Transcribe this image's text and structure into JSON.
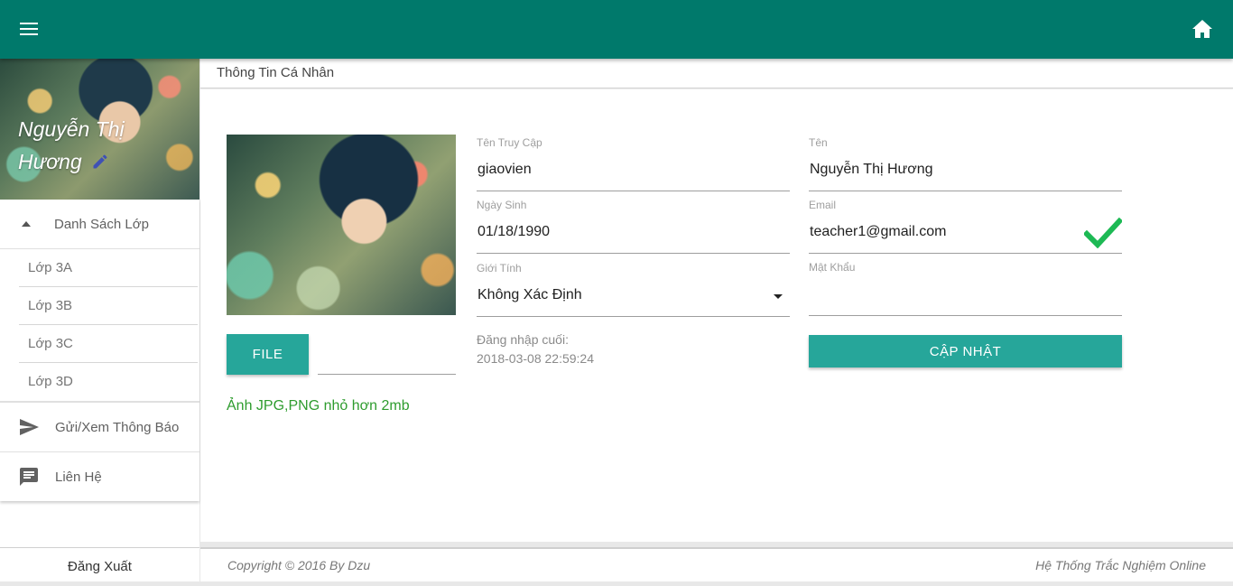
{
  "colors": {
    "primary": "#00796b",
    "button": "#26a69a",
    "success": "#2e9c2e",
    "check": "#1db954"
  },
  "topbar": {
    "menu_icon": "menu-icon",
    "home_icon": "home-icon"
  },
  "sidebar": {
    "profile_name": "Nguyễn Thị Hương",
    "edit_icon": "pencil-icon",
    "class_group": {
      "label": "Danh Sách Lớp",
      "items": [
        "Lớp 3A",
        "Lớp 3B",
        "Lớp 3C",
        "Lớp 3D"
      ]
    },
    "items": [
      {
        "label": "Gửi/Xem Thông Báo",
        "icon": "send-icon"
      },
      {
        "label": "Liên Hệ",
        "icon": "chat-icon"
      }
    ],
    "logout_label": "Đăng Xuất"
  },
  "main": {
    "title": "Thông Tin Cá Nhân",
    "file_button": "FILE",
    "file_note": "Ảnh JPG,PNG nhỏ hơn 2mb",
    "fields": {
      "username": {
        "label": "Tên Truy Cập",
        "value": "giaovien"
      },
      "name": {
        "label": "Tên",
        "value": "Nguyễn Thị Hương"
      },
      "birthday": {
        "label": "Ngày Sinh",
        "value": "01/18/1990"
      },
      "email": {
        "label": "Email",
        "value": "teacher1@gmail.com"
      },
      "gender": {
        "label": "Giới Tính",
        "value": "Không Xác Định"
      },
      "password": {
        "label": "Mật Khẩu",
        "value": ""
      }
    },
    "last_login_label": "Đăng nhập cuối:",
    "last_login_value": "2018-03-08 22:59:24",
    "update_button": "CẬP NHẬT"
  },
  "footer": {
    "copyright": "Copyright © 2016 By Dzu",
    "system": "Hệ Thống Trắc Nghiệm Online"
  }
}
